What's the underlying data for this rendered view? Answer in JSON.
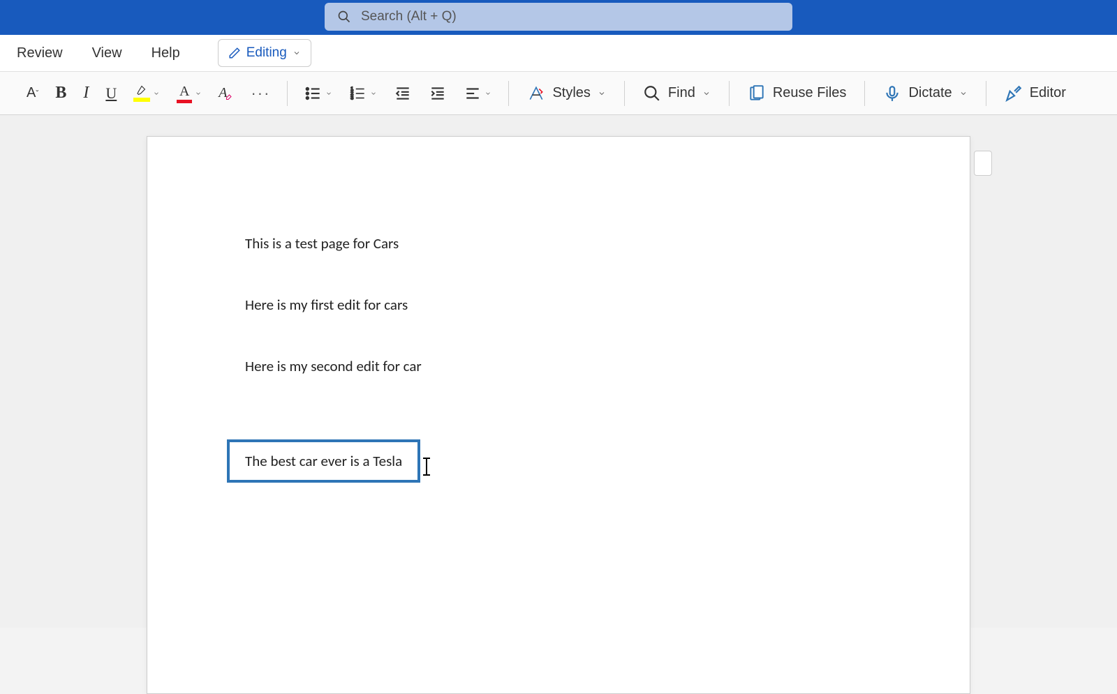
{
  "search": {
    "placeholder": "Search (Alt + Q)"
  },
  "tabs": {
    "review": "Review",
    "view": "View",
    "help": "Help"
  },
  "editing_mode": {
    "label": "Editing"
  },
  "toolbar": {
    "styles": "Styles",
    "find": "Find",
    "reuse_files": "Reuse Files",
    "dictate": "Dictate",
    "editor": "Editor"
  },
  "document": {
    "lines": [
      "This is a test page for Cars",
      "Here is my first edit for cars",
      "Here is my second edit for car"
    ],
    "textbox": "The best car ever is a Tesla"
  }
}
